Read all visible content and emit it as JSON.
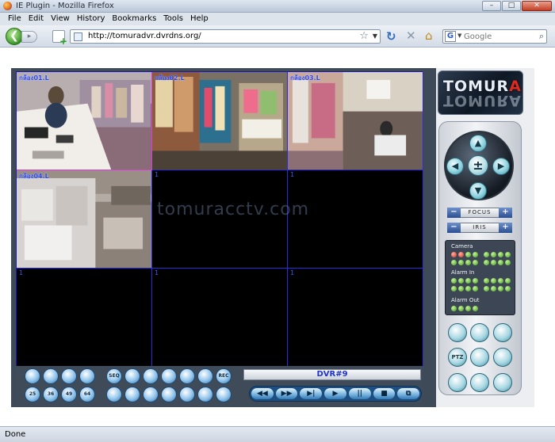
{
  "window": {
    "title": "IE Plugin - Mozilla Firefox",
    "buttons": {
      "minimize": "–",
      "maximize": "□",
      "close": "✕"
    }
  },
  "menu": [
    "File",
    "Edit",
    "View",
    "History",
    "Bookmarks",
    "Tools",
    "Help"
  ],
  "nav": {
    "url": "http://tomuradvr.dvrdns.org/",
    "search_placeholder": "Google",
    "search_engine_letter": "G"
  },
  "status": "Done",
  "logo": {
    "text_a": "TOMUR",
    "text_b": "A"
  },
  "watermark": "tomuracctv.com",
  "grid": {
    "cells": [
      {
        "label": "กล้อง01.L",
        "live": true,
        "scene": "desk"
      },
      {
        "label": "กล้อง02.L",
        "live": true,
        "scene": "shelves"
      },
      {
        "label": "กล้อง03.L",
        "live": true,
        "scene": "office"
      },
      {
        "label": "กล้อง04.L",
        "live": true,
        "scene": "storage"
      },
      {
        "label": "1",
        "live": false
      },
      {
        "label": "1",
        "live": false
      },
      {
        "label": "1",
        "live": false
      },
      {
        "label": "1",
        "live": false
      },
      {
        "label": "1",
        "live": false
      }
    ]
  },
  "dvr_label": "DVR#9",
  "ptz": {
    "up": "▲",
    "down": "▼",
    "left": "◀",
    "right": "▶",
    "center": "±"
  },
  "lens": {
    "focus": "FOCUS",
    "iris": "IRIS",
    "minus": "−",
    "plus": "+"
  },
  "indicators": {
    "camera_label": "Camera",
    "alarm_in_label": "Alarm In",
    "alarm_out_label": "Alarm Out"
  },
  "function_buttons": [
    "",
    "",
    "",
    "PTZ",
    "",
    "",
    "",
    "",
    ""
  ],
  "layout_buttons": {
    "row1": [
      "",
      "",
      "",
      "",
      "SEQ",
      "",
      "",
      "",
      "",
      "",
      "REC"
    ],
    "row2": [
      "25",
      "36",
      "49",
      "64",
      "",
      "",
      "",
      "",
      "",
      "",
      ""
    ]
  },
  "playback": [
    "◀◀",
    "▶▶",
    "▶|",
    "▶",
    "||",
    "■",
    "⧉"
  ]
}
